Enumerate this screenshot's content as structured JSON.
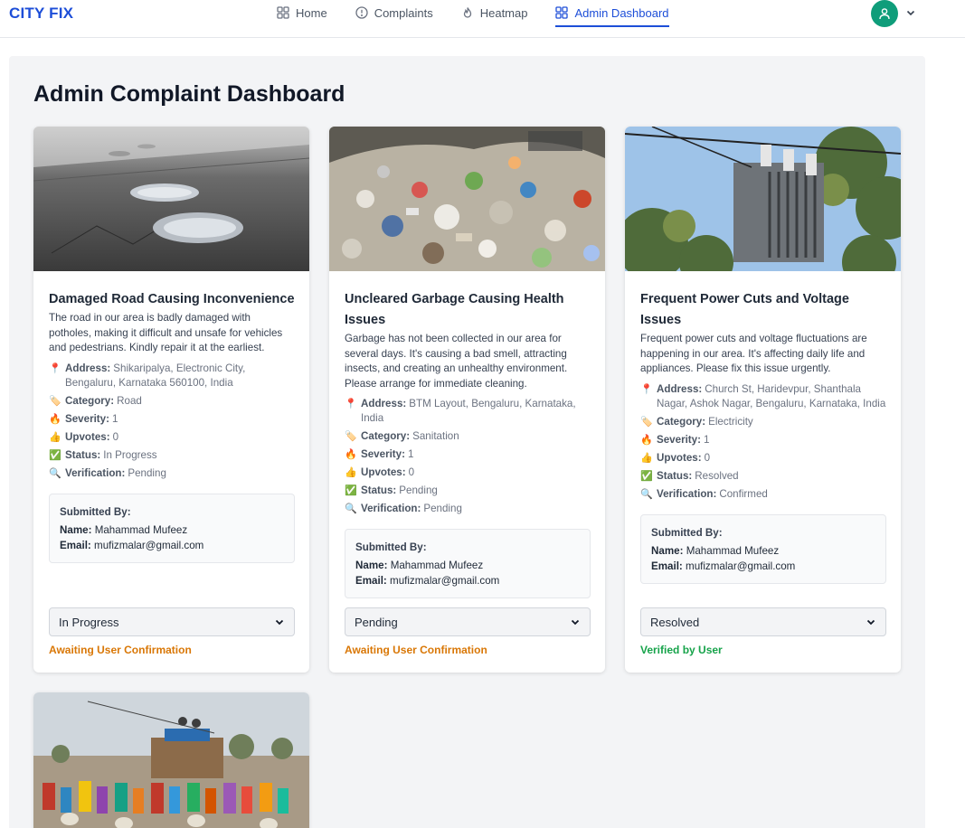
{
  "nav": {
    "brand": "CITY FIX",
    "links": [
      {
        "label": "Home",
        "icon": "grid-icon"
      },
      {
        "label": "Complaints",
        "icon": "alert-circle-icon"
      },
      {
        "label": "Heatmap",
        "icon": "flame-icon"
      },
      {
        "label": "Admin Dashboard",
        "icon": "dashboard-icon",
        "active": true
      }
    ],
    "avatar_color": "#0f9d7a"
  },
  "page": {
    "title": "Admin Complaint Dashboard"
  },
  "labels": {
    "address": "Address:",
    "category": "Category:",
    "severity": "Severity:",
    "upvotes": "Upvotes:",
    "status": "Status:",
    "verification": "Verification:",
    "submitted_by": "Submitted By:",
    "name": "Name:",
    "email": "Email:"
  },
  "complaints": [
    {
      "title": "Damaged Road Causing Inconvenience",
      "description": "The road in our area is badly damaged with potholes, making it difficult and unsafe for vehicles and pedestrians. Kindly repair it at the earliest.",
      "address": "Shikaripalya, Electronic City, Bengaluru, Karnataka 560100, India",
      "category": "Road",
      "severity": "1",
      "upvotes": "0",
      "status": "In Progress",
      "verification": "Pending",
      "submitter_name": "Mahammad Mufeez",
      "submitter_email": "mufizmalar@gmail.com",
      "select_value": "In Progress",
      "note": "Awaiting User Confirmation",
      "note_color": "#d97706"
    },
    {
      "title": "Uncleared Garbage Causing Health Issues",
      "description": "Garbage has not been collected in our area for several days. It's causing a bad smell, attracting insects, and creating an unhealthy environment. Please arrange for immediate cleaning.",
      "address": "BTM Layout, Bengaluru, Karnataka, India",
      "category": "Sanitation",
      "severity": "1",
      "upvotes": "0",
      "status": "Pending",
      "verification": "Pending",
      "submitter_name": "Mahammad Mufeez",
      "submitter_email": "mufizmalar@gmail.com",
      "select_value": "Pending",
      "note": "Awaiting User Confirmation",
      "note_color": "#d97706"
    },
    {
      "title": "Frequent Power Cuts and Voltage Issues",
      "description": "Frequent power cuts and voltage fluctuations are happening in our area. It's affecting daily life and appliances. Please fix this issue urgently.",
      "address": "Church St, Haridevpur, Shanthala Nagar, Ashok Nagar, Bengaluru, Karnataka, India",
      "category": "Electricity",
      "severity": "1",
      "upvotes": "0",
      "status": "Resolved",
      "verification": "Confirmed",
      "submitter_name": "Mahammad Mufeez",
      "submitter_email": "mufizmalar@gmail.com",
      "select_value": "Resolved",
      "note": "Verified by User",
      "note_color": "#16a34a"
    }
  ]
}
